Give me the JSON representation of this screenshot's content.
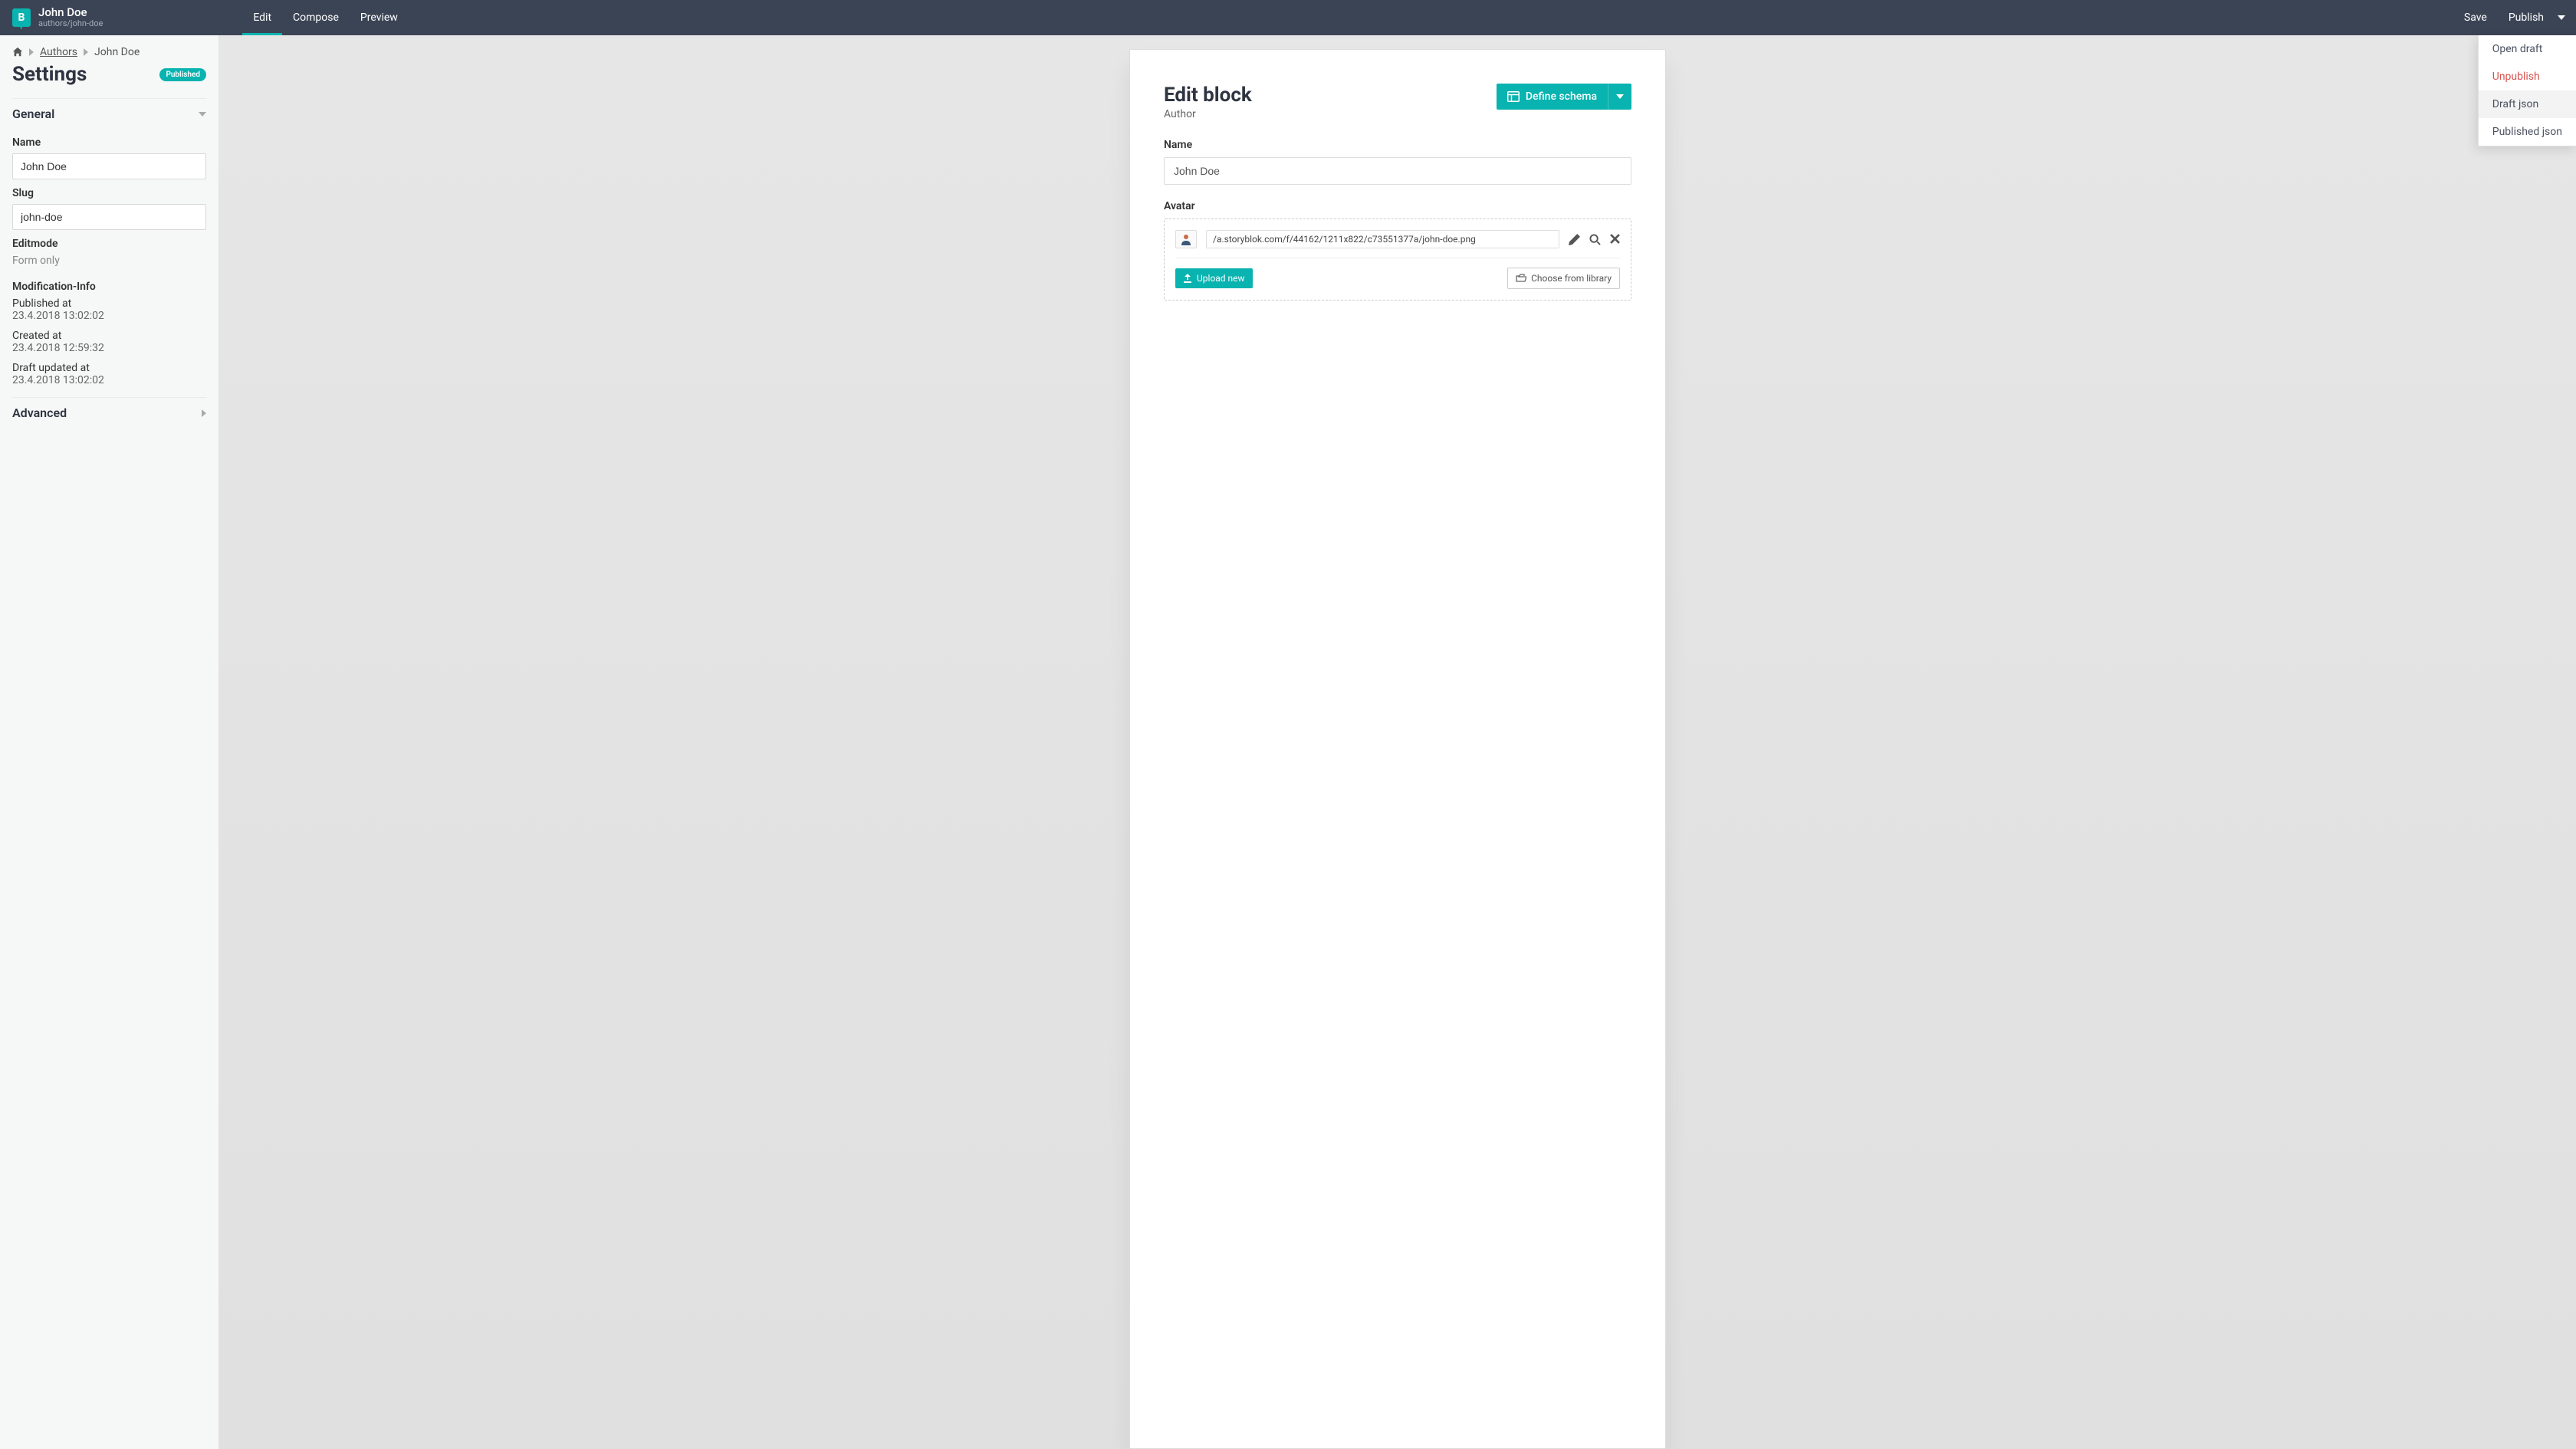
{
  "header": {
    "title": "John Doe",
    "subtitle": "authors/john-doe",
    "logo_letter": "B",
    "tabs": [
      {
        "label": "Edit",
        "active": true
      },
      {
        "label": "Compose",
        "active": false
      },
      {
        "label": "Preview",
        "active": false
      }
    ],
    "actions": {
      "save": "Save",
      "publish": "Publish"
    }
  },
  "dropdown": {
    "items": [
      {
        "label": "Open draft",
        "danger": false,
        "hovered": false
      },
      {
        "label": "Unpublish",
        "danger": true,
        "hovered": false
      },
      {
        "label": "Draft json",
        "danger": false,
        "hovered": true
      },
      {
        "label": "Published json",
        "danger": false,
        "hovered": false
      }
    ]
  },
  "sidebar": {
    "breadcrumb": {
      "home_icon": "home",
      "link": "Authors",
      "current": "John Doe"
    },
    "settings_title": "Settings",
    "status_badge": "Published",
    "sections": {
      "general": {
        "title": "General",
        "expanded": true,
        "fields": {
          "name": {
            "label": "Name",
            "value": "John Doe"
          },
          "slug": {
            "label": "Slug",
            "value": "john-doe"
          },
          "editmode": {
            "label": "Editmode",
            "value": "Form only"
          }
        },
        "modinfo": {
          "title": "Modification-Info",
          "published": {
            "label": "Published at",
            "value": "23.4.2018 13:02:02"
          },
          "created": {
            "label": "Created at",
            "value": "23.4.2018 12:59:32"
          },
          "draft": {
            "label": "Draft updated at",
            "value": "23.4.2018 13:02:02"
          }
        }
      },
      "advanced": {
        "title": "Advanced",
        "expanded": false
      }
    }
  },
  "editblock": {
    "title": "Edit block",
    "subtitle": "Author",
    "define_schema_label": "Define schema",
    "fields": {
      "name": {
        "label": "Name",
        "value": "John Doe"
      },
      "avatar": {
        "label": "Avatar",
        "url": "/a.storyblok.com/f/44162/1211x822/c73551377a/john-doe.png",
        "upload_label": "Upload new",
        "library_label": "Choose from library"
      }
    }
  }
}
